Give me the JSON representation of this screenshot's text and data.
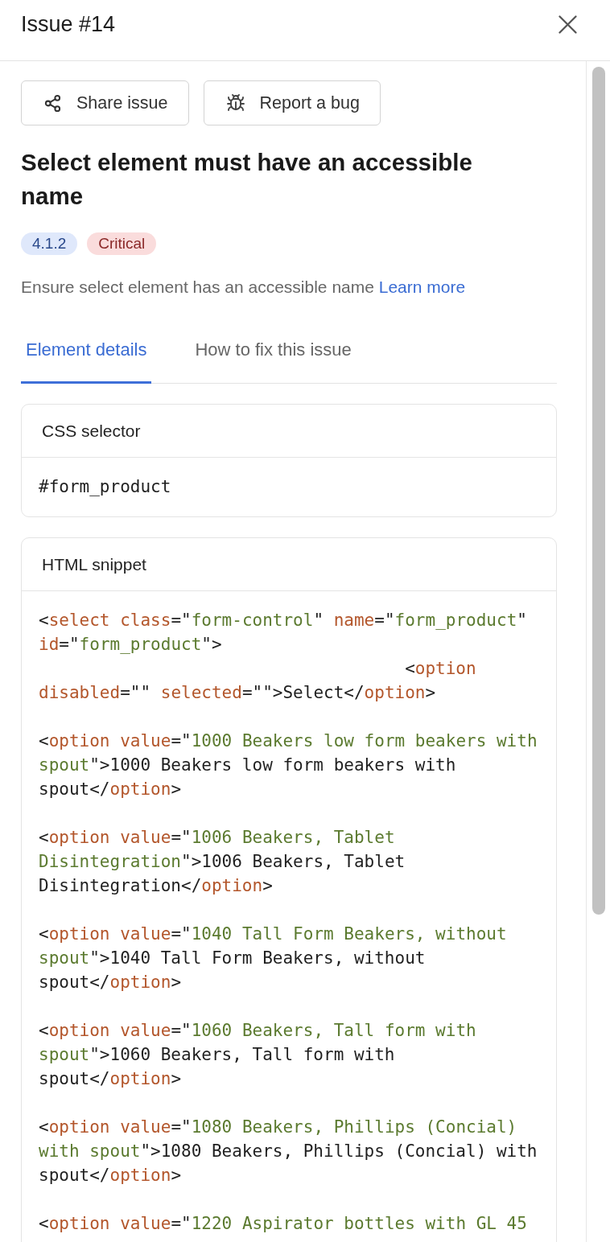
{
  "header": {
    "title": "Issue #14"
  },
  "actions": [
    {
      "kind": "share",
      "label": "Share issue"
    },
    {
      "kind": "bug",
      "label": "Report a bug"
    }
  ],
  "issue": {
    "title": "Select element must have an accessible name",
    "tags": [
      {
        "label": "4.1.2",
        "color": "#dfe8fb"
      },
      {
        "label": "Critical",
        "color": "#fadcdc"
      }
    ],
    "description": {
      "text": "Ensure select element has an accessible name",
      "link": "Learn more"
    }
  },
  "tabs": [
    {
      "label": "Element details",
      "selected": true
    },
    {
      "label": "How to fix this issue",
      "selected": false
    }
  ],
  "css_selector": {
    "heading": "CSS selector",
    "value": "#form_product"
  },
  "html_snippet": {
    "heading": "HTML snippet",
    "blocks": [
      [
        [
          {
            "kind": "plain",
            "text": "<"
          },
          {
            "kind": "name",
            "text": "select class"
          },
          {
            "kind": "plain",
            "text": "=\""
          },
          {
            "kind": "string",
            "text": "form-control"
          },
          {
            "kind": "plain",
            "text": "\" "
          },
          {
            "kind": "name",
            "text": "name"
          },
          {
            "kind": "plain",
            "text": "=\""
          },
          {
            "kind": "string",
            "text": "form_product"
          },
          {
            "kind": "plain",
            "text": "\""
          }
        ],
        [
          {
            "kind": "name",
            "text": "id"
          },
          {
            "kind": "plain",
            "text": "=\""
          },
          {
            "kind": "string",
            "text": "form_product"
          },
          {
            "kind": "plain",
            "text": "\">"
          }
        ],
        [
          {
            "kind": "plain",
            "text": "                                    <"
          },
          {
            "kind": "name",
            "text": "option"
          }
        ],
        [
          {
            "kind": "name",
            "text": "disabled"
          },
          {
            "kind": "plain",
            "text": "=\"\" "
          },
          {
            "kind": "name",
            "text": "selected"
          },
          {
            "kind": "plain",
            "text": "=\"\">Select</"
          },
          {
            "kind": "name",
            "text": "option"
          },
          {
            "kind": "plain",
            "text": ">"
          }
        ]
      ],
      [
        [
          {
            "kind": "plain",
            "text": "<"
          },
          {
            "kind": "name",
            "text": "option value"
          },
          {
            "kind": "plain",
            "text": "=\""
          },
          {
            "kind": "string",
            "text": "1000 Beakers low form beakers with"
          }
        ],
        [
          {
            "kind": "string",
            "text": "spout"
          },
          {
            "kind": "plain",
            "text": "\">1000 Beakers low form beakers with"
          }
        ],
        [
          {
            "kind": "plain",
            "text": "spout</"
          },
          {
            "kind": "name",
            "text": "option"
          },
          {
            "kind": "plain",
            "text": ">"
          }
        ]
      ],
      [
        [
          {
            "kind": "plain",
            "text": "<"
          },
          {
            "kind": "name",
            "text": "option value"
          },
          {
            "kind": "plain",
            "text": "=\""
          },
          {
            "kind": "string",
            "text": "1006 Beakers, Tablet"
          }
        ],
        [
          {
            "kind": "string",
            "text": "Disintegration"
          },
          {
            "kind": "plain",
            "text": "\">1006 Beakers, Tablet"
          }
        ],
        [
          {
            "kind": "plain",
            "text": "Disintegration</"
          },
          {
            "kind": "name",
            "text": "option"
          },
          {
            "kind": "plain",
            "text": ">"
          }
        ]
      ],
      [
        [
          {
            "kind": "plain",
            "text": "<"
          },
          {
            "kind": "name",
            "text": "option value"
          },
          {
            "kind": "plain",
            "text": "=\""
          },
          {
            "kind": "string",
            "text": "1040 Tall Form Beakers, without"
          }
        ],
        [
          {
            "kind": "string",
            "text": "spout"
          },
          {
            "kind": "plain",
            "text": "\">1040 Tall Form Beakers, without"
          }
        ],
        [
          {
            "kind": "plain",
            "text": "spout</"
          },
          {
            "kind": "name",
            "text": "option"
          },
          {
            "kind": "plain",
            "text": ">"
          }
        ]
      ],
      [
        [
          {
            "kind": "plain",
            "text": "<"
          },
          {
            "kind": "name",
            "text": "option value"
          },
          {
            "kind": "plain",
            "text": "=\""
          },
          {
            "kind": "string",
            "text": "1060 Beakers, Tall form with"
          }
        ],
        [
          {
            "kind": "string",
            "text": "spout"
          },
          {
            "kind": "plain",
            "text": "\">1060 Beakers, Tall form with"
          }
        ],
        [
          {
            "kind": "plain",
            "text": "spout</"
          },
          {
            "kind": "name",
            "text": "option"
          },
          {
            "kind": "plain",
            "text": ">"
          }
        ]
      ],
      [
        [
          {
            "kind": "plain",
            "text": "<"
          },
          {
            "kind": "name",
            "text": "option value"
          },
          {
            "kind": "plain",
            "text": "=\""
          },
          {
            "kind": "string",
            "text": "1080 Beakers, Phillips (Concial)"
          }
        ],
        [
          {
            "kind": "string",
            "text": "with spout"
          },
          {
            "kind": "plain",
            "text": "\">1080 Beakers, Phillips (Concial) with"
          }
        ],
        [
          {
            "kind": "plain",
            "text": "spout</"
          },
          {
            "kind": "name",
            "text": "option"
          },
          {
            "kind": "plain",
            "text": ">"
          }
        ]
      ],
      [
        [
          {
            "kind": "plain",
            "text": "<"
          },
          {
            "kind": "name",
            "text": "option value"
          },
          {
            "kind": "plain",
            "text": "=\""
          },
          {
            "kind": "string",
            "text": "1220 Aspirator bottles with GL 45"
          }
        ]
      ]
    ]
  }
}
